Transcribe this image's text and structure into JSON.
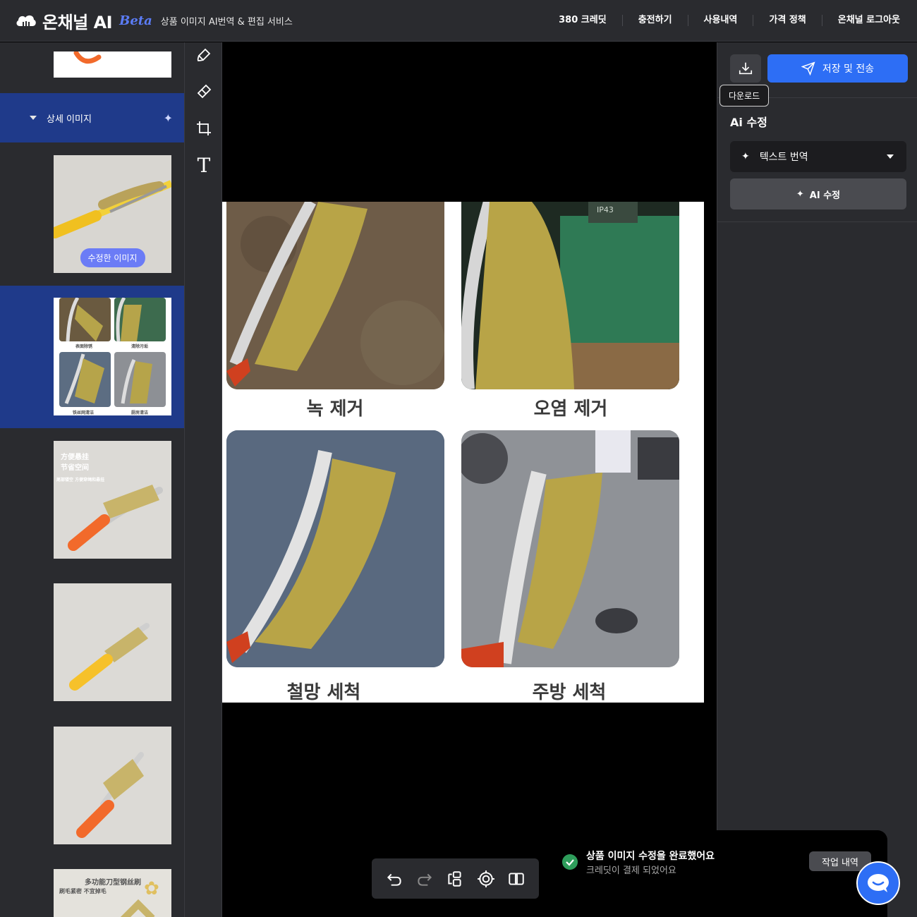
{
  "header": {
    "brand": "온채널 AI",
    "beta": "Beta",
    "tagline": "상품 이미지 AI번역 & 편집 서비스",
    "nav": [
      "380 크레딧",
      "충전하기",
      "사용내역",
      "가격 정책",
      "온채널 로그아웃"
    ]
  },
  "left_rail": {
    "section_label": "상세 이미지",
    "edited_badge": "수정한 이미지",
    "thumb_grid_captions": [
      "表面除锈",
      "清除污垢",
      "铁丝网清洁",
      "厨房清洁"
    ],
    "thumb_hang_text": [
      "方便悬挂",
      "节省空间",
      "尾部镂空 方便穿绳和悬挂"
    ],
    "thumb_last_text": [
      "多功能刀型钢丝刷",
      "刷毛紧密 不宜掉毛"
    ]
  },
  "canvas": {
    "captions": [
      "녹 제거",
      "오염 제거",
      "철망 세척",
      "주방 세척"
    ],
    "stamp": "IP43"
  },
  "right_panel": {
    "download_tooltip": "다운로드",
    "save_label": "저장 및 전송",
    "ai_title": "Ai 수정",
    "mode_label": "텍스트 번역",
    "ai_button": "AI 수정"
  },
  "toast": {
    "title": "상품 이미지 수정을 완료했어요",
    "subtitle": "크레딧이 결제 되었어요"
  },
  "job_history_label": "작업 내역",
  "colors": {
    "accent": "#2d6ef5",
    "sidebar_active": "#1f3a8a",
    "panel_bg": "#2a2b2f",
    "badge": "#6b7cf6",
    "success": "#2e9d5b"
  },
  "icons": [
    "download-icon",
    "send-icon",
    "sparkle-icon",
    "undo-icon",
    "redo-icon",
    "layers-icon",
    "target-icon",
    "compare-icon",
    "brush-icon",
    "eraser-icon",
    "crop-icon",
    "text-icon",
    "chat-icon",
    "check-icon"
  ]
}
